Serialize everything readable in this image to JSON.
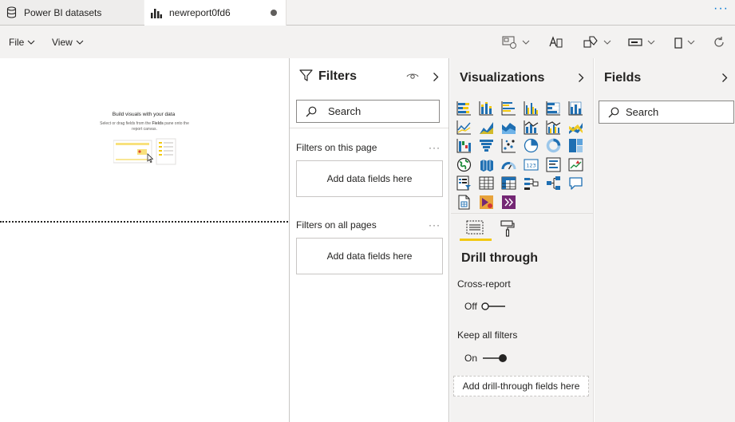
{
  "tabs": [
    {
      "label": "Power BI datasets",
      "icon": "database-icon"
    },
    {
      "label": "newreport0fd6",
      "icon": "bar-chart-icon",
      "unsaved": true
    }
  ],
  "tabbar": {
    "more": "···"
  },
  "menu": {
    "file": "File",
    "view": "View"
  },
  "ribbon_icons": [
    "page-view-icon",
    "text-box-icon",
    "shapes-icon",
    "buttons-icon",
    "mobile-layout-icon",
    "refresh-icon"
  ],
  "canvas": {
    "empty_title": "Build visuals with your data",
    "empty_subtitle_prefix": "Select or drag fields from the ",
    "empty_subtitle_bold": "Fields",
    "empty_subtitle_suffix": " pane onto the report canvas."
  },
  "filters": {
    "title": "Filters",
    "search_placeholder": "Search",
    "on_this_page": "Filters on this page",
    "on_all_pages": "Filters on all pages",
    "add_fields": "Add data fields here",
    "more": "···"
  },
  "visualizations": {
    "title": "Visualizations",
    "icons": [
      "stacked-bar-chart-icon",
      "stacked-column-chart-icon",
      "clustered-bar-chart-icon",
      "clustered-column-chart-icon",
      "100-stacked-bar-chart-icon",
      "100-stacked-column-chart-icon",
      "line-chart-icon",
      "area-chart-icon",
      "stacked-area-chart-icon",
      "line-and-stacked-column-chart-icon",
      "line-and-clustered-column-chart-icon",
      "ribbon-chart-icon",
      "waterfall-chart-icon",
      "funnel-chart-icon",
      "scatter-chart-icon",
      "pie-chart-icon",
      "donut-chart-icon",
      "treemap-icon",
      "map-icon",
      "filled-map-icon",
      "gauge-icon",
      "card-icon",
      "multi-row-card-icon",
      "kpi-icon",
      "slicer-icon",
      "table-icon",
      "matrix-icon",
      "key-influencers-icon",
      "decomposition-tree-icon",
      "qa-icon",
      "paginated-report-icon",
      "power-apps-icon",
      "power-automate-icon"
    ],
    "build_tab": "fields-well-icon",
    "format_tab": "paint-roller-icon",
    "drill_title": "Drill through",
    "cross_report": "Cross-report",
    "cross_report_state": "Off",
    "keep_filters": "Keep all filters",
    "keep_filters_state": "On",
    "add_drill": "Add drill-through fields here"
  },
  "fields": {
    "title": "Fields",
    "search_placeholder": "Search"
  }
}
